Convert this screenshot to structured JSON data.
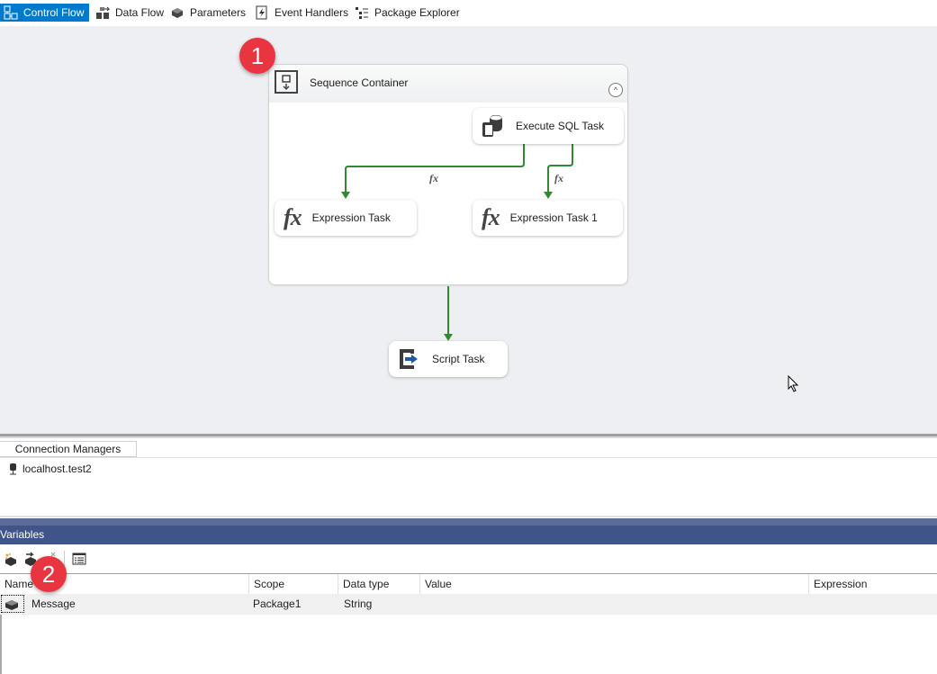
{
  "designer_tabs": [
    {
      "label": "Control Flow",
      "icon": "control-flow-icon",
      "active": true
    },
    {
      "label": "Data Flow",
      "icon": "data-flow-icon",
      "active": false
    },
    {
      "label": "Parameters",
      "icon": "parameters-icon",
      "active": false
    },
    {
      "label": "Event Handlers",
      "icon": "event-handlers-icon",
      "active": false
    },
    {
      "label": "Package Explorer",
      "icon": "package-explorer-icon",
      "active": false
    }
  ],
  "canvas": {
    "container": {
      "title": "Sequence Container",
      "collapse_glyph": "^"
    },
    "tasks": {
      "execute_sql": "Execute SQL Task",
      "expression_1": "Expression Task",
      "expression_2": "Expression Task 1",
      "script": "Script Task"
    },
    "precedence_label": "fx",
    "fx_glyph": "fx",
    "colors": {
      "connector": "#2e8b2e",
      "accent": "#007acc",
      "badge": "#e8353f"
    }
  },
  "badges": [
    "1",
    "2"
  ],
  "connection_managers": {
    "tab_label": "Connection Managers",
    "items": [
      "localhost.test2"
    ]
  },
  "variables": {
    "title": "Variables",
    "columns": [
      "Name",
      "Scope",
      "Data type",
      "Value",
      "Expression"
    ],
    "rows": [
      {
        "name": "Message",
        "scope": "Package1",
        "data_type": "String",
        "value": "",
        "expression": ""
      }
    ]
  }
}
